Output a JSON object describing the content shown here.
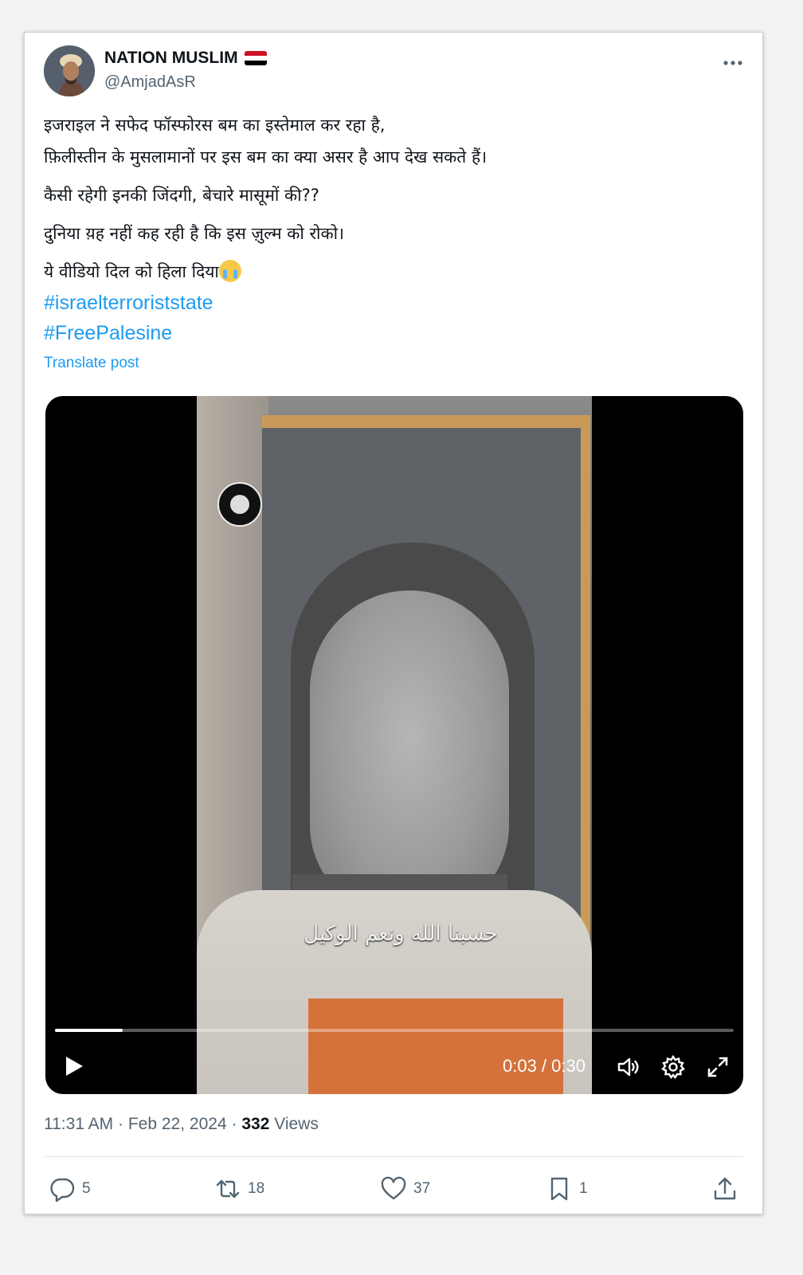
{
  "author": {
    "display_name": "NATION MUSLIM",
    "handle": "@AmjadAsR",
    "flag_colors": [
      "#ce1126",
      "#ffffff",
      "#000000"
    ]
  },
  "post": {
    "lines": [
      "इजराइल ने सफेद फॉस्फोरस बम का इस्तेमाल कर रहा है,",
      "फ़िलीस्तीन के मुसलामानों पर इस बम का क्या असर है आप देख सकते हैं।",
      "कैसी रहेगी इनकी जिंदगी, बेचारे मासूमों की??",
      "दुनिया य़ह नहीं कह रही है कि इस ज़ुल्म को रोको।",
      "ये वीडियो दिल को हिला दिया"
    ],
    "emoji_name": "loudly-crying-face-emoji",
    "hashtags": [
      "#israelterroriststate",
      "#FreePalesine"
    ],
    "translate_label": "Translate post"
  },
  "video": {
    "caption": "حسبنا الله ونعم الوكيل",
    "time_display": "0:03 / 0:30",
    "progress_fraction": 0.1,
    "icons": [
      "play-icon",
      "volume-icon",
      "settings-gear-icon",
      "fullscreen-icon"
    ]
  },
  "meta": {
    "time": "11:31 AM",
    "date": "Feb 22, 2024",
    "views_count": "332",
    "views_label": "Views",
    "separator": "·"
  },
  "actions": {
    "replies": "5",
    "reposts": "18",
    "likes": "37",
    "bookmarks": "1"
  },
  "colors": {
    "link": "#1d9bf0",
    "secondary_text": "#536471",
    "primary_text": "#0f1419"
  }
}
